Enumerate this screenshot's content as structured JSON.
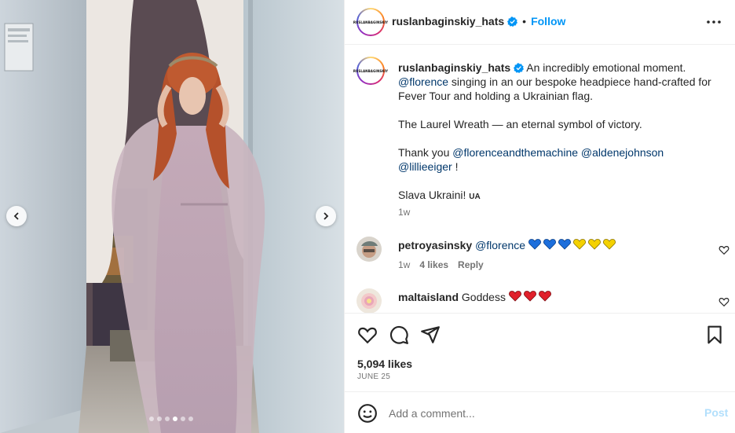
{
  "header": {
    "avatar_text": "RUSLANBAGINSKIY",
    "username": "ruslanbaginskiy_hats",
    "separator": "•",
    "follow_label": "Follow"
  },
  "caption": {
    "username": "ruslanbaginskiy_hats",
    "line1_text": "An incredibly emotional moment.",
    "mention_florence": "@florence",
    "line2_text": "singing in an our bespoke headpiece hand-crafted for Fever Tour and holding a Ukrainian flag.",
    "para2": "The Laurel Wreath — an eternal symbol of victory.",
    "thanks_text": "Thank you",
    "mention_fatm": "@florenceandthemachine",
    "mention_aldene": "@aldenejohnson",
    "mention_lillie": "@lillieeiger",
    "thanks_end": "!",
    "para4": "Slava Ukraini!",
    "country_code": "UA",
    "time": "1w"
  },
  "comments": [
    {
      "username": "petroyasinsky",
      "mention": "@florence",
      "hearts": [
        "blue",
        "blue",
        "blue",
        "yellow",
        "yellow",
        "yellow"
      ],
      "time": "1w",
      "likes": "4 likes",
      "reply": "Reply"
    },
    {
      "username": "maltaisland",
      "text": "Goddess",
      "hearts": [
        "red",
        "red",
        "red"
      ]
    }
  ],
  "likes_label": "5,094 likes",
  "date": "JUNE 25",
  "comment_box": {
    "placeholder": "Add a comment...",
    "post_label": "Post"
  },
  "carousel": {
    "slide_count": 6,
    "active_index": 3
  },
  "colors": {
    "link": "#00376b",
    "follow": "#0095f6",
    "verified": "#0095f6",
    "post_disabled": "#b2dffc"
  },
  "icons": [
    "chevron-left-icon",
    "chevron-right-icon",
    "verified-badge-icon",
    "more-icon",
    "heart-icon",
    "comment-icon",
    "share-icon",
    "bookmark-icon",
    "emoji-icon"
  ]
}
